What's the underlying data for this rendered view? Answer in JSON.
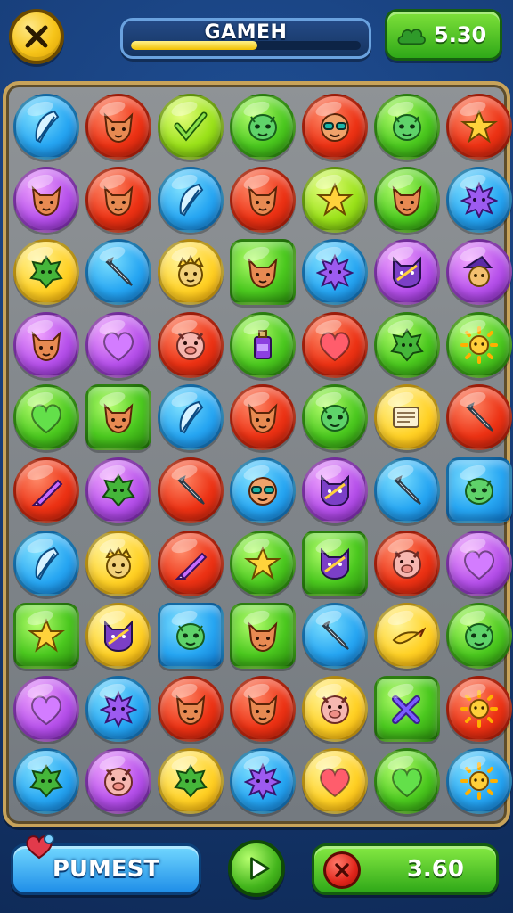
{
  "header": {
    "title": "GAMEH",
    "progress": 0.55,
    "score": "5.30"
  },
  "bottom": {
    "left_button_label": "PUMEST",
    "value": "3.60"
  },
  "board": {
    "columns": 7,
    "rows": [
      [
        [
          "blue",
          "feather"
        ],
        [
          "red",
          "fox-face"
        ],
        [
          "lime",
          "check"
        ],
        [
          "green",
          "alien-face"
        ],
        [
          "red",
          "glasses-face"
        ],
        [
          "green",
          "alien-face"
        ],
        [
          "red",
          "star"
        ]
      ],
      [
        [
          "purple",
          "fox-face"
        ],
        [
          "red",
          "fox-face"
        ],
        [
          "blue",
          "feather"
        ],
        [
          "red",
          "fox-face"
        ],
        [
          "lime",
          "star"
        ],
        [
          "green",
          "fox-face"
        ],
        [
          "blue",
          "spiky-blob"
        ]
      ],
      [
        [
          "yellow",
          "leaf-creature"
        ],
        [
          "blue",
          "pencil"
        ],
        [
          "yellow",
          "crown-face"
        ],
        [
          "green-sq",
          "fox-face"
        ],
        [
          "blue",
          "spiky-blob"
        ],
        [
          "purple",
          "cat-face"
        ],
        [
          "purple",
          "witch-face"
        ]
      ],
      [
        [
          "purple",
          "fox-face"
        ],
        [
          "purple",
          "heart"
        ],
        [
          "red",
          "pig-face"
        ],
        [
          "green",
          "potion"
        ],
        [
          "red",
          "heart"
        ],
        [
          "green",
          "leaf-creature"
        ],
        [
          "green",
          "sun"
        ]
      ],
      [
        [
          "green",
          "heart"
        ],
        [
          "green-sq",
          "fox-face"
        ],
        [
          "blue",
          "feather"
        ],
        [
          "red",
          "fox-face"
        ],
        [
          "green",
          "alien-face"
        ],
        [
          "yellow",
          "papers"
        ],
        [
          "red",
          "pencil"
        ]
      ],
      [
        [
          "red",
          "crayon"
        ],
        [
          "purple",
          "leaf-creature"
        ],
        [
          "red",
          "pencil"
        ],
        [
          "blue",
          "glasses-face"
        ],
        [
          "purple",
          "cat-face"
        ],
        [
          "blue",
          "pencil"
        ],
        [
          "blue-sq",
          "alien-face"
        ]
      ],
      [
        [
          "blue",
          "feather"
        ],
        [
          "yellow",
          "crown-face"
        ],
        [
          "red",
          "crayon"
        ],
        [
          "green",
          "star"
        ],
        [
          "green-sq",
          "cat-face"
        ],
        [
          "red",
          "pig-face"
        ],
        [
          "purple",
          "heart"
        ]
      ],
      [
        [
          "green-sq",
          "star"
        ],
        [
          "yellow",
          "cat-face"
        ],
        [
          "blue-sq",
          "alien-face"
        ],
        [
          "green-sq",
          "fox-face"
        ],
        [
          "blue",
          "pencil"
        ],
        [
          "yellow",
          "bird"
        ],
        [
          "green",
          "alien-face"
        ]
      ],
      [
        [
          "purple",
          "heart"
        ],
        [
          "blue",
          "spiky-blob"
        ],
        [
          "red",
          "fox-face"
        ],
        [
          "red",
          "fox-face"
        ],
        [
          "yellow",
          "pig-face"
        ],
        [
          "green-sq",
          "x-mark"
        ],
        [
          "red",
          "sun"
        ]
      ],
      [
        [
          "blue",
          "leaf-creature"
        ],
        [
          "purple",
          "pig-face"
        ],
        [
          "yellow",
          "leaf-creature"
        ],
        [
          "blue",
          "spiky-blob"
        ],
        [
          "yellow",
          "heart"
        ],
        [
          "green",
          "heart"
        ],
        [
          "blue",
          "sun"
        ]
      ]
    ]
  }
}
